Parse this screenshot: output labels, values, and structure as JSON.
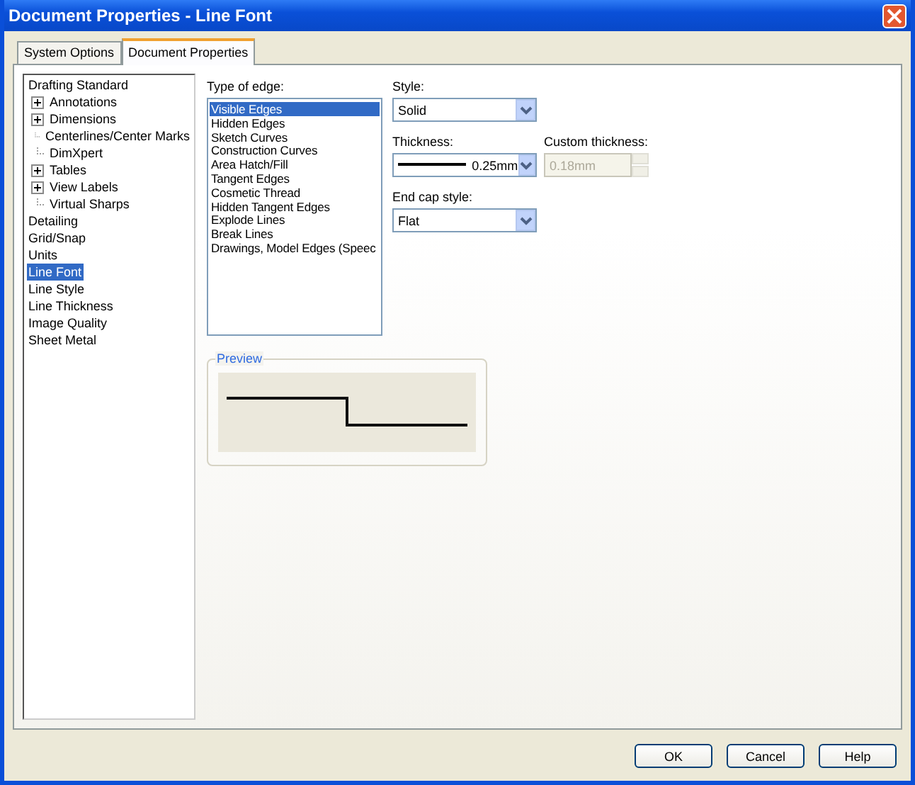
{
  "window": {
    "title": "Document Properties - Line Font"
  },
  "tabs": [
    {
      "label": "System Options",
      "selected": false
    },
    {
      "label": "Document Properties",
      "selected": true
    }
  ],
  "tree": [
    {
      "label": "Drafting Standard",
      "selected": false,
      "children": [
        {
          "label": "Annotations",
          "selected": false,
          "expanded": false
        },
        {
          "label": "Dimensions",
          "selected": false,
          "expanded": false
        },
        {
          "label": "Centerlines/Center Marks",
          "selected": false
        },
        {
          "label": "DimXpert",
          "selected": false
        },
        {
          "label": "Tables",
          "selected": false,
          "expanded": false
        },
        {
          "label": "View Labels",
          "selected": false,
          "expanded": false
        },
        {
          "label": "Virtual Sharps",
          "selected": false
        }
      ]
    },
    {
      "label": "Detailing",
      "selected": false
    },
    {
      "label": "Grid/Snap",
      "selected": false
    },
    {
      "label": "Units",
      "selected": false
    },
    {
      "label": "Line Font",
      "selected": true
    },
    {
      "label": "Line Style",
      "selected": false
    },
    {
      "label": "Line Thickness",
      "selected": false
    },
    {
      "label": "Image Quality",
      "selected": false
    },
    {
      "label": "Sheet Metal",
      "selected": false
    }
  ],
  "edge_types": {
    "label": "Type of edge:",
    "items": [
      {
        "label": "Visible Edges",
        "selected": true
      },
      {
        "label": "Hidden Edges",
        "selected": false
      },
      {
        "label": "Sketch Curves",
        "selected": false
      },
      {
        "label": "Construction Curves",
        "selected": false
      },
      {
        "label": "Area Hatch/Fill",
        "selected": false
      },
      {
        "label": "Tangent Edges",
        "selected": false
      },
      {
        "label": "Cosmetic Thread",
        "selected": false
      },
      {
        "label": "Hidden Tangent Edges",
        "selected": false
      },
      {
        "label": "Explode Lines",
        "selected": false
      },
      {
        "label": "Break Lines",
        "selected": false
      },
      {
        "label": "Drawings, Model Edges (Speec",
        "selected": false
      }
    ]
  },
  "style": {
    "label": "Style:",
    "value": "Solid"
  },
  "thickness": {
    "label": "Thickness:",
    "value": "0.25mm"
  },
  "custom_thickness": {
    "label": "Custom thickness:",
    "value": "0.18mm",
    "disabled": true
  },
  "end_cap": {
    "label": "End cap style:",
    "value": "Flat"
  },
  "preview": {
    "label": "Preview"
  },
  "buttons": [
    "OK",
    "Cancel",
    "Help"
  ]
}
